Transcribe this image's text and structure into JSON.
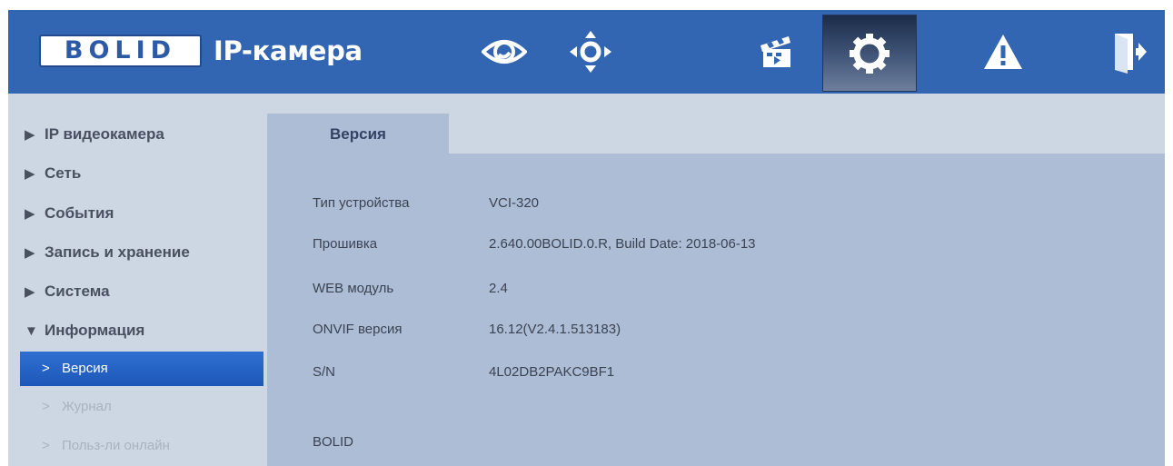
{
  "header": {
    "logo_text": "BOLID",
    "title": "IP-камера",
    "nav_icons": [
      "eye-icon",
      "ptz-icon",
      "clapperboard-icon",
      "gear-icon",
      "warning-icon",
      "logout-icon"
    ],
    "active_icon": "gear-icon"
  },
  "sidebar": {
    "sections": [
      {
        "label": "IP видеокамера",
        "arrow": "▶"
      },
      {
        "label": "Сеть",
        "arrow": "▶"
      },
      {
        "label": "События",
        "arrow": "▶"
      },
      {
        "label": "Запись и хранение",
        "arrow": "▶"
      },
      {
        "label": "Система",
        "arrow": "▶"
      },
      {
        "label": "Информация",
        "arrow": "▼"
      }
    ],
    "subitems": [
      {
        "label": "Версия",
        "chevron": ">"
      },
      {
        "label": "Журнал",
        "chevron": ">"
      },
      {
        "label": "Польз-ли онлайн",
        "chevron": ">"
      }
    ],
    "active_subitem": "Версия"
  },
  "main": {
    "tab_label": "Версия",
    "rows": [
      {
        "label": "Тип устройства",
        "value": "VCI-320"
      },
      {
        "label": "Прошивка",
        "value": "2.640.00BOLID.0.R, Build Date: 2018-06-13"
      },
      {
        "label": "WEB модуль",
        "value": "2.4"
      },
      {
        "label": "ONVIF версия",
        "value": "16.12(V2.4.1.513183)"
      },
      {
        "label": "S/N",
        "value": "4L02DB2PAKC9BF1"
      }
    ],
    "footer_text": "BOLID"
  },
  "colors": {
    "header_bg": "#3366b2",
    "sidebar_bg": "#cdd6e3",
    "content_bg": "#adbdd6",
    "active_item": "#2463c6"
  }
}
